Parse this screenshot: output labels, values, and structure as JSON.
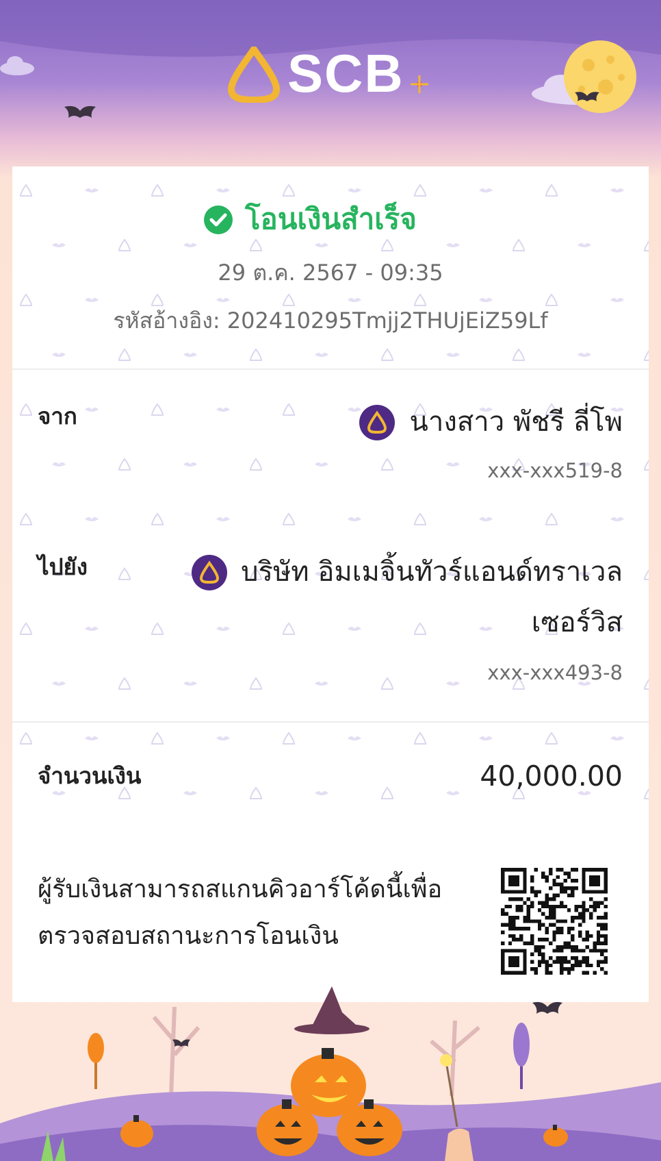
{
  "brand": {
    "logo_text": "SCB"
  },
  "status": {
    "text": "โอนเงินสำเร็จ",
    "color": "#27b45e"
  },
  "transaction": {
    "datetime": "29 ต.ค. 2567 - 09:35",
    "ref_label": "รหัสอ้างอิง:",
    "ref_value": "202410295Tmjj2THUjEiZ59Lf"
  },
  "from": {
    "label": "จาก",
    "name": "นางสาว พัชรี ลี่โพ",
    "account": "xxx-xxx519-8",
    "bank_icon": "scb-bank-icon"
  },
  "to": {
    "label": "ไปยัง",
    "name_line1": "บริษัท อิมเมจิ้นทัวร์แอนด์ทราเวล",
    "name_line2": "เซอร์วิส",
    "account": "xxx-xxx493-8",
    "bank_icon": "scb-bank-icon"
  },
  "amount": {
    "label": "จำนวนเงิน",
    "value": "40,000.00"
  },
  "qr": {
    "text_line1": "ผู้รับเงินสามารถสแกนคิวอาร์โค้ดนี้เพื่อ",
    "text_line2": "ตรวจสอบสถานะการโอนเงิน",
    "icon": "qr-code-icon"
  },
  "theme": {
    "header_purple": "#8a6ac4",
    "bank_purple": "#4e2a84",
    "gold": "#f2b632",
    "pumpkin": "#f5891f"
  }
}
